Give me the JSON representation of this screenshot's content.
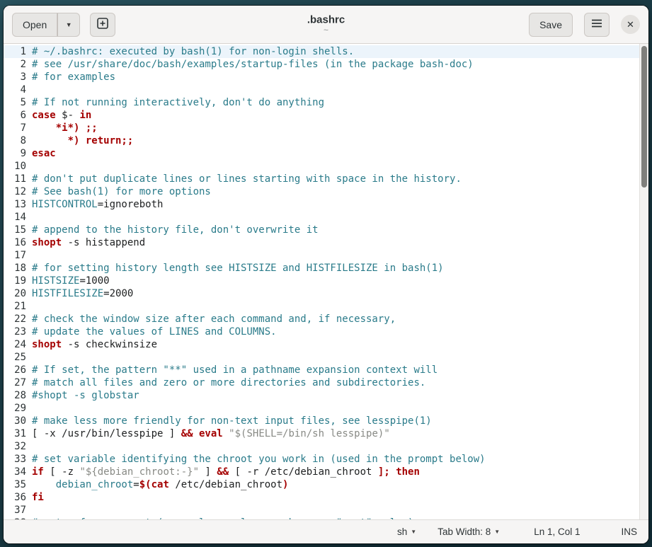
{
  "header": {
    "open_label": "Open",
    "open_arrow": "▼",
    "title": ".bashrc",
    "subtitle": "~",
    "save_label": "Save",
    "close_glyph": "✕"
  },
  "colors": {
    "comment": "#2a7b8a",
    "keyword": "#a40000",
    "variable": "#2a7b8a",
    "string": "#888a85",
    "current_line_bg": "#ecf4fb",
    "headerbar_bg": "#f6f5f4"
  },
  "statusbar": {
    "language": "sh",
    "tab_width": "Tab Width: 8",
    "position": "Ln 1, Col 1",
    "mode": "INS",
    "arrow": "▼"
  },
  "editor": {
    "current_line": 1,
    "lines": [
      {
        "n": 1,
        "s": [
          {
            "c": "comment",
            "t": "# ~/.bashrc: executed by bash(1) for non-login shells."
          }
        ]
      },
      {
        "n": 2,
        "s": [
          {
            "c": "comment",
            "t": "# see /usr/share/doc/bash/examples/startup-files (in the package bash-doc)"
          }
        ]
      },
      {
        "n": 3,
        "s": [
          {
            "c": "comment",
            "t": "# for examples"
          }
        ]
      },
      {
        "n": 4,
        "s": []
      },
      {
        "n": 5,
        "s": [
          {
            "c": "comment",
            "t": "# If not running interactively, don't do anything"
          }
        ]
      },
      {
        "n": 6,
        "s": [
          {
            "c": "keyword",
            "t": "case"
          },
          {
            "c": "plain",
            "t": " $- "
          },
          {
            "c": "keyword",
            "t": "in"
          }
        ]
      },
      {
        "n": 7,
        "s": [
          {
            "c": "plain",
            "t": "    "
          },
          {
            "c": "keyword",
            "t": "*i*) ;;"
          }
        ]
      },
      {
        "n": 8,
        "s": [
          {
            "c": "plain",
            "t": "      "
          },
          {
            "c": "keyword",
            "t": "*) return;;"
          }
        ]
      },
      {
        "n": 9,
        "s": [
          {
            "c": "keyword",
            "t": "esac"
          }
        ]
      },
      {
        "n": 10,
        "s": []
      },
      {
        "n": 11,
        "s": [
          {
            "c": "comment",
            "t": "# don't put duplicate lines or lines starting with space in the history."
          }
        ]
      },
      {
        "n": 12,
        "s": [
          {
            "c": "comment",
            "t": "# See bash(1) for more options"
          }
        ]
      },
      {
        "n": 13,
        "s": [
          {
            "c": "variable",
            "t": "HISTCONTROL"
          },
          {
            "c": "plain",
            "t": "=ignoreboth"
          }
        ]
      },
      {
        "n": 14,
        "s": []
      },
      {
        "n": 15,
        "s": [
          {
            "c": "comment",
            "t": "# append to the history file, don't overwrite it"
          }
        ]
      },
      {
        "n": 16,
        "s": [
          {
            "c": "keyword",
            "t": "shopt"
          },
          {
            "c": "plain",
            "t": " -s histappend"
          }
        ]
      },
      {
        "n": 17,
        "s": []
      },
      {
        "n": 18,
        "s": [
          {
            "c": "comment",
            "t": "# for setting history length see HISTSIZE and HISTFILESIZE in bash(1)"
          }
        ]
      },
      {
        "n": 19,
        "s": [
          {
            "c": "variable",
            "t": "HISTSIZE"
          },
          {
            "c": "plain",
            "t": "=1000"
          }
        ]
      },
      {
        "n": 20,
        "s": [
          {
            "c": "variable",
            "t": "HISTFILESIZE"
          },
          {
            "c": "plain",
            "t": "=2000"
          }
        ]
      },
      {
        "n": 21,
        "s": []
      },
      {
        "n": 22,
        "s": [
          {
            "c": "comment",
            "t": "# check the window size after each command and, if necessary,"
          }
        ]
      },
      {
        "n": 23,
        "s": [
          {
            "c": "comment",
            "t": "# update the values of LINES and COLUMNS."
          }
        ]
      },
      {
        "n": 24,
        "s": [
          {
            "c": "keyword",
            "t": "shopt"
          },
          {
            "c": "plain",
            "t": " -s checkwinsize"
          }
        ]
      },
      {
        "n": 25,
        "s": []
      },
      {
        "n": 26,
        "s": [
          {
            "c": "comment",
            "t": "# If set, the pattern \"**\" used in a pathname expansion context will"
          }
        ]
      },
      {
        "n": 27,
        "s": [
          {
            "c": "comment",
            "t": "# match all files and zero or more directories and subdirectories."
          }
        ]
      },
      {
        "n": 28,
        "s": [
          {
            "c": "comment",
            "t": "#shopt -s globstar"
          }
        ]
      },
      {
        "n": 29,
        "s": []
      },
      {
        "n": 30,
        "s": [
          {
            "c": "comment",
            "t": "# make less more friendly for non-text input files, see lesspipe(1)"
          }
        ]
      },
      {
        "n": 31,
        "s": [
          {
            "c": "plain",
            "t": "[ -x /usr/bin/lesspipe ] "
          },
          {
            "c": "keyword",
            "t": "&& eval"
          },
          {
            "c": "plain",
            "t": " "
          },
          {
            "c": "string",
            "t": "\"$(SHELL=/bin/sh lesspipe)\""
          }
        ]
      },
      {
        "n": 32,
        "s": []
      },
      {
        "n": 33,
        "s": [
          {
            "c": "comment",
            "t": "# set variable identifying the chroot you work in (used in the prompt below)"
          }
        ]
      },
      {
        "n": 34,
        "s": [
          {
            "c": "keyword",
            "t": "if"
          },
          {
            "c": "plain",
            "t": " [ -z "
          },
          {
            "c": "string",
            "t": "\"${debian_chroot:-}\""
          },
          {
            "c": "plain",
            "t": " ] "
          },
          {
            "c": "keyword",
            "t": "&&"
          },
          {
            "c": "plain",
            "t": " [ -r /etc/debian_chroot "
          },
          {
            "c": "keyword",
            "t": "];"
          },
          {
            "c": "plain",
            "t": " "
          },
          {
            "c": "keyword",
            "t": "then"
          }
        ]
      },
      {
        "n": 35,
        "s": [
          {
            "c": "plain",
            "t": "    "
          },
          {
            "c": "variable",
            "t": "debian_chroot"
          },
          {
            "c": "plain",
            "t": "="
          },
          {
            "c": "keyword",
            "t": "$(cat"
          },
          {
            "c": "plain",
            "t": " /etc/debian_chroot"
          },
          {
            "c": "keyword",
            "t": ")"
          }
        ]
      },
      {
        "n": 36,
        "s": [
          {
            "c": "keyword",
            "t": "fi"
          }
        ]
      },
      {
        "n": 37,
        "s": []
      },
      {
        "n": 38,
        "s": [
          {
            "c": "comment",
            "t": "# set a fancy prompt (non-color, unless we know we \"want\" color)"
          }
        ]
      }
    ]
  }
}
